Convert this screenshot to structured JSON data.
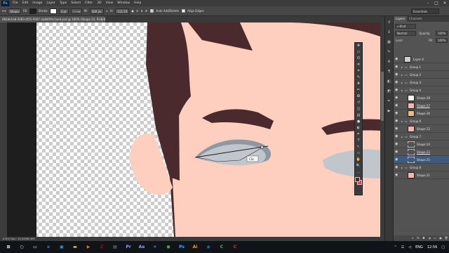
{
  "menubar": {
    "logo": "Ps",
    "items": [
      "File",
      "Edit",
      "Image",
      "Layer",
      "Type",
      "Select",
      "Filter",
      "3D",
      "View",
      "Window",
      "Help"
    ],
    "minimize": "–",
    "maximize": "□",
    "close": "✕"
  },
  "options": {
    "tool_mode": "Shape",
    "fill_label": "Fill:",
    "stroke_label": "Stroke:",
    "stroke_width": "3 pt",
    "w_label": "W:",
    "w_value": "300 px",
    "link": "∞",
    "h_label": "H:",
    "h_value": "111,74",
    "auto_add_delete": "Auto Add/Delete",
    "align_edges": "Align Edges",
    "workspace": "Essentials",
    "fill_color": "#231f20",
    "stroke_color": "#ffffff"
  },
  "document": {
    "tab_title": "082de1a8-2083-4f25-9587-3a8d0f4c1ae4.psd @ 100% (Shape 21, RGB/8)",
    "status": "100%   Doc: 19,2M/60,6M"
  },
  "canvas": {
    "tooltip": "Clic",
    "colors": {
      "skin": "#fecfbe",
      "hair": "#4a2a2c",
      "eye": "#c1c6cc",
      "eye_shadow": "#8e98a2"
    }
  },
  "floating_tools": [
    "move-icon",
    "marquee-icon",
    "lasso-icon",
    "wand-icon",
    "crop-icon",
    "eyedropper-icon",
    "heal-icon",
    "brush-icon",
    "stamp-icon",
    "history-icon",
    "eraser-icon",
    "gradient-icon",
    "blur-icon",
    "dodge-icon",
    "pen-icon",
    "type-icon",
    "path-select-icon",
    "shape-icon",
    "hand-icon",
    "zoom-icon",
    "more-icon"
  ],
  "floating_glyphs": [
    "✥",
    "▭",
    "ʘ",
    "✲",
    "⌗",
    "✎",
    "✚",
    "✏",
    "✪",
    "↺",
    "◫",
    "▤",
    "●",
    "◐",
    "✒",
    "T",
    "↖",
    "▭",
    "✋",
    "🔍",
    "…"
  ],
  "layers": {
    "tabs": [
      "Layers",
      "Channels"
    ],
    "filter": "Kind",
    "blend": "Normal",
    "opacity_label": "Opacity:",
    "opacity_value": "100%",
    "lock_label": "Lock:",
    "fill_label": "Fill:",
    "fill_value": "100%",
    "rows": [
      {
        "name": "Layer 4",
        "type": "layer",
        "indent": 0,
        "thumb": "#cfcfcf",
        "selected": false,
        "underline": false
      },
      {
        "name": "Group 1",
        "type": "group",
        "indent": 0,
        "thumb": "",
        "selected": false,
        "underline": false
      },
      {
        "name": "Group 2",
        "type": "group",
        "indent": 0,
        "thumb": "",
        "selected": false,
        "underline": false
      },
      {
        "name": "Group 3",
        "type": "group",
        "indent": 0,
        "thumb": "",
        "selected": false,
        "underline": false
      },
      {
        "name": "Group 4",
        "type": "group",
        "indent": 0,
        "thumb": "",
        "selected": false,
        "underline": false
      },
      {
        "name": "Shape 28",
        "type": "shape",
        "indent": 1,
        "thumb": "#ffffff",
        "selected": false,
        "underline": false
      },
      {
        "name": "Shape 27",
        "type": "shape",
        "indent": 1,
        "thumb": "#f2b8b0",
        "selected": false,
        "underline": true
      },
      {
        "name": "Shape 26",
        "type": "shape",
        "indent": 1,
        "thumb": "#f4b68a",
        "selected": false,
        "underline": false
      },
      {
        "name": "Group 6",
        "type": "group",
        "indent": 0,
        "thumb": "",
        "selected": false,
        "underline": false
      },
      {
        "name": "Shape 22",
        "type": "shape",
        "indent": 1,
        "thumb": "#f2b8b0",
        "selected": false,
        "underline": false
      },
      {
        "name": "Group 7",
        "type": "group",
        "indent": 0,
        "thumb": "",
        "selected": false,
        "underline": false
      },
      {
        "name": "Shape 24",
        "type": "path",
        "indent": 1,
        "thumb": "",
        "selected": false,
        "underline": false
      },
      {
        "name": "Shape 23",
        "type": "path",
        "indent": 1,
        "thumb": "",
        "selected": false,
        "underline": true
      },
      {
        "name": "Shape 25",
        "type": "path",
        "indent": 1,
        "thumb": "",
        "selected": true,
        "underline": false
      },
      {
        "name": "Group 8",
        "type": "group",
        "indent": 0,
        "thumb": "",
        "selected": false,
        "underline": false
      },
      {
        "name": "Shape 21",
        "type": "shape",
        "indent": 1,
        "thumb": "#f2b8b0",
        "selected": false,
        "underline": false
      }
    ],
    "footer_icons": [
      "link-icon",
      "fx-icon",
      "mask-icon",
      "adjustment-icon",
      "folder-icon",
      "new-layer-icon",
      "trash-icon"
    ],
    "footer_glyphs": [
      "∞",
      "fx",
      "◘",
      "◑",
      "▭",
      "▣",
      "🗑"
    ]
  },
  "right_strip": [
    "history-icon",
    "properties-icon",
    "swatches-icon",
    "brush-presets-icon",
    "character-icon",
    "paragraph-icon",
    "layers-icon",
    "channels-icon",
    "paths-icon",
    "actions-icon"
  ],
  "right_strip_glyphs": [
    "↺",
    "ℹ",
    "▦",
    "✎",
    "A",
    "¶",
    "◧",
    "◩",
    "✒",
    "▶"
  ],
  "taskbar": {
    "icons": [
      {
        "name": "windows-start-icon",
        "glyph": "⊞",
        "color": "#ffffff"
      },
      {
        "name": "search-icon",
        "glyph": "○",
        "color": "#ffffff"
      },
      {
        "name": "task-view-icon",
        "glyph": "▭",
        "color": "#ffffff"
      },
      {
        "name": "edge-icon",
        "glyph": "e",
        "color": "#3277bc"
      },
      {
        "name": "store-icon",
        "glyph": "▣",
        "color": "#3a96dd"
      },
      {
        "name": "explorer-icon",
        "glyph": "▬",
        "color": "#f7c948"
      },
      {
        "name": "media-icon",
        "glyph": "▶",
        "color": "#e07a2e"
      },
      {
        "name": "filezilla-icon",
        "glyph": "Z",
        "color": "#bf0000"
      },
      {
        "name": "ps-app-icon",
        "glyph": "▤",
        "color": "#8a8a8a"
      },
      {
        "name": "premiere-icon",
        "glyph": "Pr",
        "color": "#9999ff"
      },
      {
        "name": "aftereffects-icon",
        "glyph": "Ae",
        "color": "#9999ff"
      },
      {
        "name": "vscode-icon",
        "glyph": "✕",
        "color": "#3ea6e8"
      },
      {
        "name": "camtasia-icon",
        "glyph": "●",
        "color": "#43a047"
      },
      {
        "name": "photoshop-icon",
        "glyph": "Ps",
        "color": "#31a8ff"
      },
      {
        "name": "illustrator-icon",
        "glyph": "Ai",
        "color": "#ff9a00"
      },
      {
        "name": "cinema4d-icon",
        "glyph": "◉",
        "color": "#2f6bd9"
      },
      {
        "name": "corel-icon",
        "glyph": "C",
        "color": "#57b443"
      },
      {
        "name": "coreldraw-icon",
        "glyph": "C",
        "color": "#e53935"
      }
    ],
    "tray": {
      "language": "ENG",
      "time": "12:56"
    }
  }
}
